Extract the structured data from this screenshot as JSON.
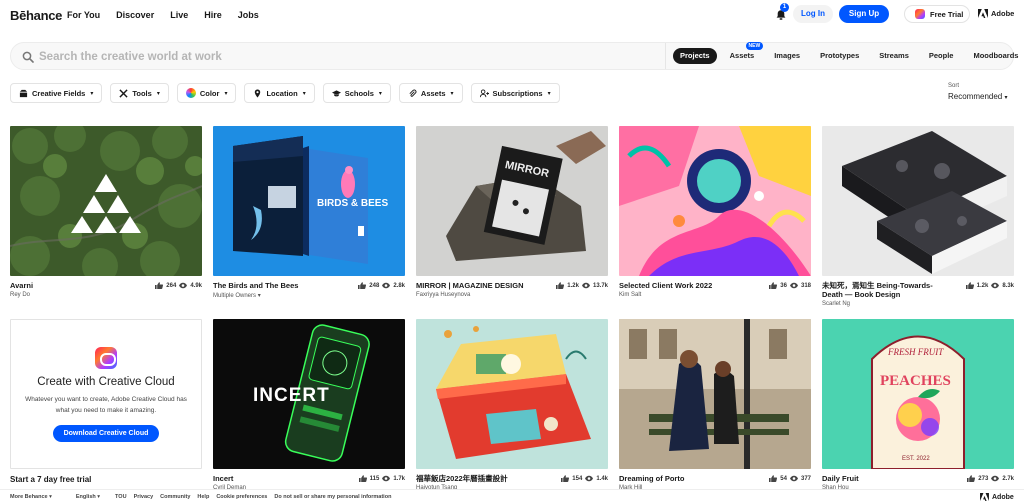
{
  "brand": "Bēhance",
  "nav": [
    "For You",
    "Discover",
    "Live",
    "Hire",
    "Jobs"
  ],
  "notifications": {
    "count": "1"
  },
  "auth": {
    "login": "Log In",
    "signup": "Sign Up"
  },
  "free_trial": "Free Trial",
  "adobe": "Adobe",
  "search": {
    "placeholder": "Search the creative world at work",
    "tabs": [
      "Projects",
      "Assets",
      "Images",
      "Prototypes",
      "Streams",
      "People",
      "Moodboards"
    ],
    "active_tab": "Projects",
    "new_badge": "NEW"
  },
  "filters": [
    "Creative Fields",
    "Tools",
    "Color",
    "Location",
    "Schools",
    "Assets",
    "Subscriptions"
  ],
  "sort": {
    "label": "Sort",
    "value": "Recommended"
  },
  "projects": [
    {
      "title": "Avarni",
      "owner": "Rey Do",
      "likes": "264",
      "views": "4.9k"
    },
    {
      "title": "The Birds and The Bees",
      "owner": "Multiple Owners",
      "likes": "248",
      "views": "2.8k"
    },
    {
      "title": "MIRROR | MAGAZINE DESIGN",
      "owner": "Faxriyya Huseynova",
      "likes": "1.2k",
      "views": "13.7k"
    },
    {
      "title": "Selected Client Work 2022",
      "owner": "Kim Salt",
      "likes": "36",
      "views": "318"
    },
    {
      "title": "未知死，焉知生 Being-Towards-Death — Book Design",
      "owner": "Scarlet Ng",
      "likes": "1.2k",
      "views": "8.3k"
    },
    {
      "title": "Incert",
      "owner": "Cyril Deman",
      "likes": "115",
      "views": "1.7k"
    },
    {
      "title": "福華飯店2022年曆插畫設計",
      "owner": "Haiyotun Tsang",
      "likes": "154",
      "views": "1.4k"
    },
    {
      "title": "Dreaming of Porto",
      "owner": "Mark Hill",
      "likes": "54",
      "views": "377"
    },
    {
      "title": "Daily Fruit",
      "owner": "Shan Hou",
      "likes": "273",
      "views": "2.7k"
    }
  ],
  "cc_promo": {
    "title": "Create with Creative Cloud",
    "text": "Whatever you want to create, Adobe Creative Cloud has what you need to make it amazing.",
    "button": "Download Creative Cloud",
    "footer": "Start a 7 day free trial"
  },
  "thumb_text": {
    "birds": "BIRDS & BEES",
    "mirror": "MIRROR",
    "incert": "INCERT",
    "fruit_top": "FRESH FRUIT",
    "fruit_main": "PEACHES",
    "fruit_year": "EST. 2022"
  },
  "footer": [
    "More Behance ▾",
    "English ▾",
    "TOU",
    "Privacy",
    "Community",
    "Help",
    "Cookie preferences",
    "Do not sell or share my personal information"
  ],
  "colors": {
    "accent": "#0057ff",
    "text": "#191919"
  }
}
